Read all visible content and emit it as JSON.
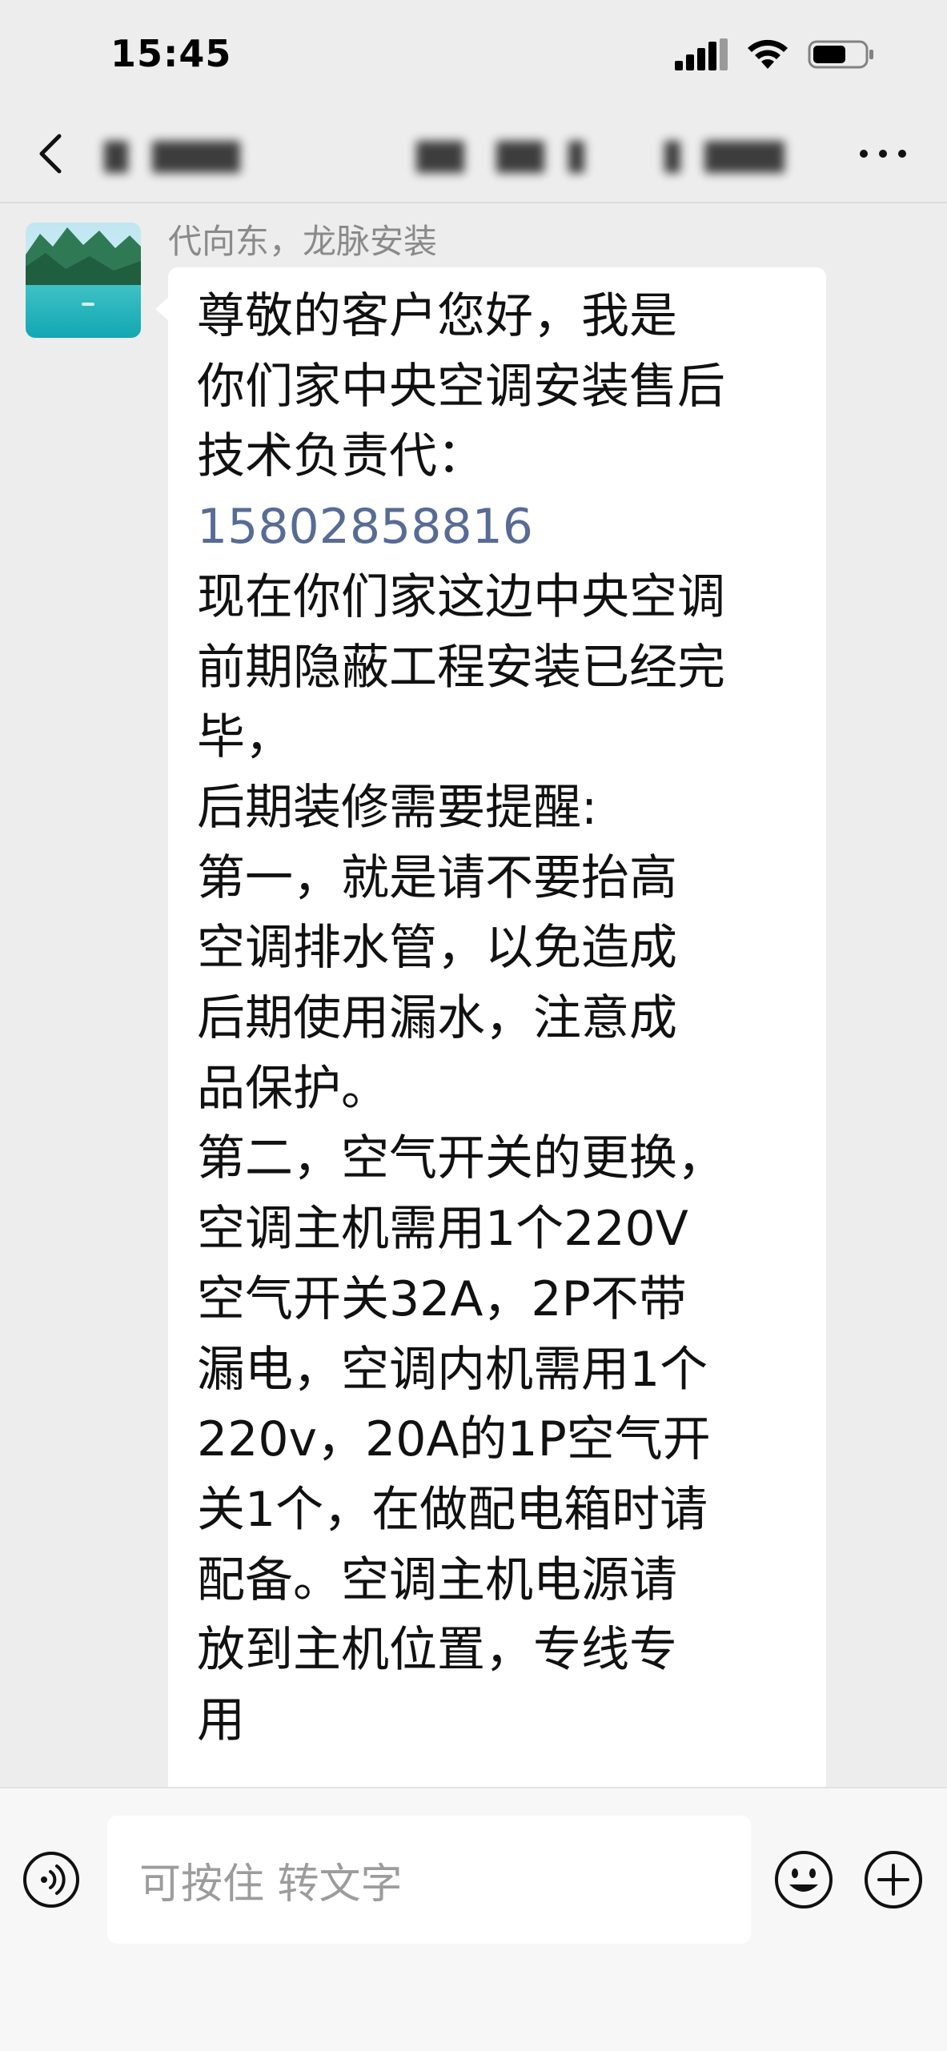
{
  "status_bar": {
    "time": "15:45"
  },
  "nav": {
    "title": "",
    "back_icon": "chevron-left-icon",
    "more_icon": "more-dots-icon"
  },
  "chat": {
    "sender_name": "代向东，龙脉安装",
    "message_lines": [
      "尊敬的客户您好，我是",
      "你们家中央空调安装售后",
      "技术负责代：",
      "15802858816",
      "现在你们家这边中央空调",
      "前期隐蔽工程安装已经完",
      "毕，",
      "后期装修需要提醒:",
      "第一，就是请不要抬高",
      "空调排水管，以免造成",
      "后期使用漏水，注意成",
      "品保护。",
      "第二，空气开关的更换，",
      "空调主机需用1个220V",
      "空气开关32A，2P不带",
      "漏电，空调内机需用1个",
      "220v，20A的1P空气开",
      "关1个，在做配电箱时请",
      "配备。空调主机电源请",
      "放到主机位置，专线专",
      "用"
    ],
    "phone_line_index": 3
  },
  "input_bar": {
    "placeholder": "可按住 转文字",
    "voice_icon": "voice-icon",
    "emoji_icon": "emoji-icon",
    "plus_icon": "plus-icon"
  },
  "colors": {
    "background": "#ededed",
    "bubble": "#ffffff",
    "link": "#576b95",
    "secondary_text": "#8a8a8a"
  }
}
